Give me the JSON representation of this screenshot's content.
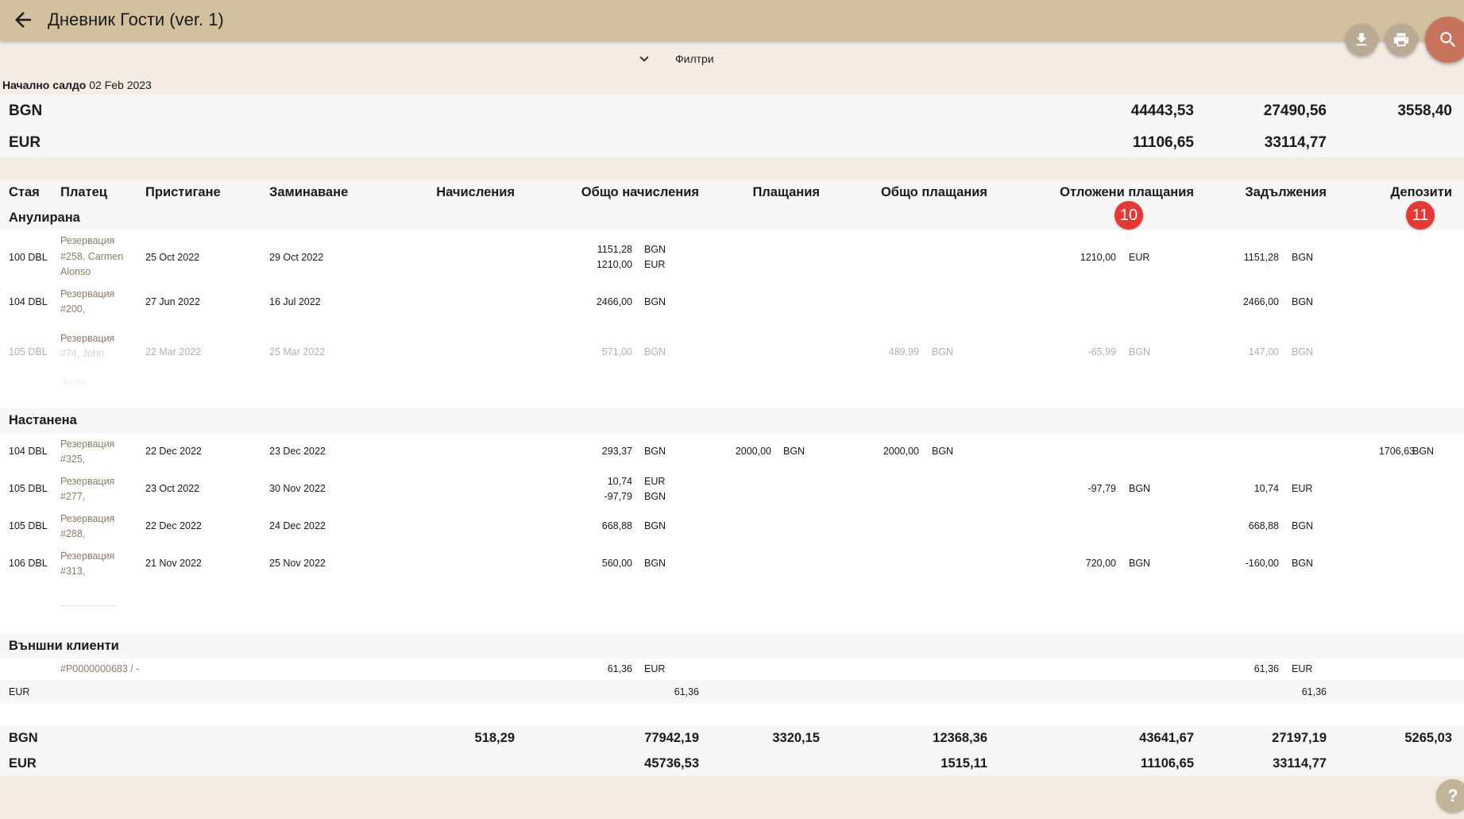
{
  "app": {
    "title": "Дневник Гости (ver. 1)"
  },
  "filters": {
    "label": "Филтри"
  },
  "opening": {
    "label": "Начално салдо",
    "date": "02 Feb 2023"
  },
  "opening_totals": [
    {
      "currency": "BGN",
      "c1": "44443,53",
      "c2": "27490,56",
      "c3": "3558,40"
    },
    {
      "currency": "EUR",
      "c1": "11106,65",
      "c2": "33114,77",
      "c3": ""
    }
  ],
  "columns": {
    "room": "Стая",
    "payer": "Платец",
    "arrival": "Пристигане",
    "departure": "Заминаване",
    "charges": "Начисления",
    "total_charges": "Общо начисления",
    "payments": "Плащания",
    "total_payments": "Общо плащания",
    "deferred": "Отложени плащания",
    "debts": "Задължения",
    "deposits": "Депозити"
  },
  "badges": {
    "deferred": "10",
    "deposits": "11"
  },
  "groups": {
    "cancelled": {
      "title": "Анулирана",
      "rows": [
        {
          "room": "100 DBL",
          "payer": [
            "Резервация",
            "#258, Carmen",
            "Alonso"
          ],
          "arrival": "25 Oct 2022",
          "departure": "29 Oct 2022",
          "tc1": "1151,28",
          "tc1c": "BGN",
          "tc2": "1210,00",
          "tc2c": "EUR",
          "def": "1210,00",
          "defc": "EUR",
          "debt": "1151,28",
          "debtc": "BGN"
        },
        {
          "room": "104 DBL",
          "payer": [
            "Резервация",
            "#200,"
          ],
          "arrival": "27 Jun 2022",
          "departure": "16 Jul 2022",
          "tc1": "2466,00",
          "tc1c": "BGN",
          "debt": "2466,00",
          "debtc": "BGN"
        },
        {
          "room": "105 DBL",
          "payer": [
            "Резервация",
            "#74, John",
            "Smith"
          ],
          "arrival": "22 Mar 2022",
          "departure": "25 Mar 2022",
          "tc1": "571,00",
          "tc1c": "BGN",
          "tp": "489,99",
          "tpc": "BGN",
          "def": "-65,99",
          "defc": "BGN",
          "debt": "147,00",
          "debtc": "BGN"
        }
      ]
    },
    "accommodated": {
      "title": "Настанена",
      "rows": [
        {
          "room": "104 DBL",
          "payer": [
            "Резервация",
            "#325,"
          ],
          "arrival": "22 Dec 2022",
          "departure": "23 Dec 2022",
          "tc1": "293,37",
          "tc1c": "BGN",
          "pay": "2000,00",
          "payc": "BGN",
          "tp": "2000,00",
          "tpc": "BGN",
          "dep": "1706,63",
          "depc": "BGN"
        },
        {
          "room": "105 DBL",
          "payer": [
            "Резервация",
            "#277,"
          ],
          "arrival": "23 Oct 2022",
          "departure": "30 Nov 2022",
          "tc1": "10,74",
          "tc1c": "EUR",
          "tc2": "-97,79",
          "tc2c": "BGN",
          "def": "-97,79",
          "defc": "BGN",
          "debt": "10,74",
          "debtc": "EUR"
        },
        {
          "room": "105 DBL",
          "payer": [
            "Резервация",
            "#288,"
          ],
          "arrival": "22 Dec 2022",
          "departure": "24 Dec 2022",
          "tc1": "668,88",
          "tc1c": "BGN",
          "debt": "668,88",
          "debtc": "BGN"
        },
        {
          "room": "106 DBL",
          "payer": [
            "Резервация",
            "#313,"
          ],
          "arrival": "21 Nov 2022",
          "departure": "25 Nov 2022",
          "tc1": "560,00",
          "tc1c": "BGN",
          "def": "720,00",
          "defc": "BGN",
          "debt": "-160,00",
          "debtc": "BGN"
        }
      ]
    },
    "external": {
      "title": "Външни клиенти",
      "row": {
        "payer": "#P0000000683 / -",
        "tc1": "61,36",
        "tc1c": "EUR",
        "debt": "61,36",
        "debtc": "EUR"
      },
      "subtotal": {
        "currency": "EUR",
        "total_charges": "61,36",
        "debts": "61,36"
      }
    }
  },
  "totals": [
    {
      "currency": "BGN",
      "charges": "518,29",
      "total_charges": "77942,19",
      "payments": "3320,15",
      "total_payments": "12368,36",
      "deferred": "43641,67",
      "debts": "27197,19",
      "deposits": "5265,03"
    },
    {
      "currency": "EUR",
      "charges": "",
      "total_charges": "45736,53",
      "payments": "",
      "total_payments": "1515,11",
      "deferred": "11106,65",
      "debts": "33114,77",
      "deposits": ""
    }
  ],
  "icons": {
    "back": "arrow-left-icon",
    "download": "download-icon",
    "print": "print-icon",
    "search": "search-icon",
    "filters": "chevron-down-icon",
    "help": "help-icon"
  },
  "colors": {
    "topbar": "#d2c09f",
    "background": "#f4ebe2",
    "search_fab": "#c8735b",
    "badge": "#e53935",
    "payer_text": "#8a7d68"
  }
}
